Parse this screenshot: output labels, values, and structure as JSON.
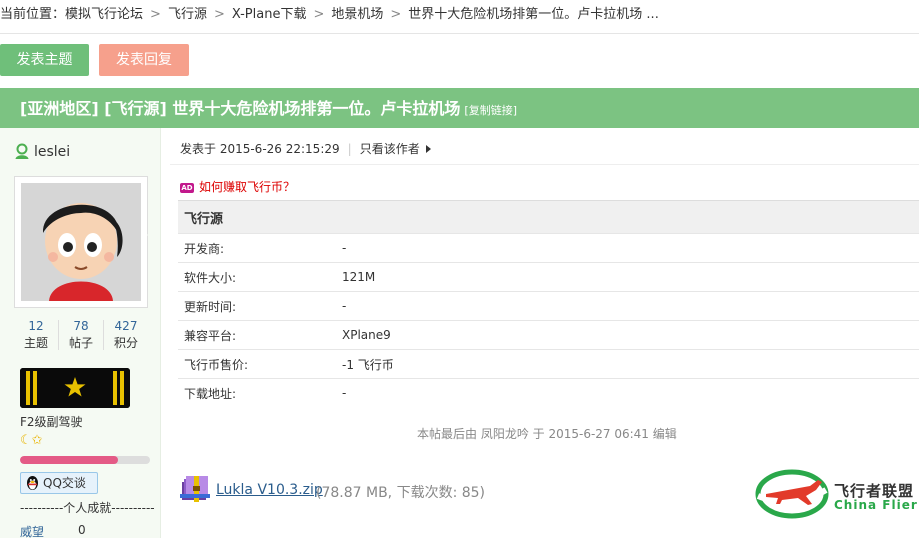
{
  "breadcrumb": {
    "prefix": "当前位置：",
    "items": [
      "模拟飞行论坛",
      "飞行源",
      "X-Plane下载",
      "地景机场",
      "世界十大危险机场排第一位。卢卡拉机场 ..."
    ],
    "separator": ">"
  },
  "actions": {
    "post_label": "发表主题",
    "reply_label": "发表回复"
  },
  "thread": {
    "title": "[亚洲地区] [飞行源] 世界十大危险机场排第一位。卢卡拉机场",
    "copy_link": "[复制链接]"
  },
  "author": {
    "name": "leslei",
    "stats": [
      {
        "num": "12",
        "label": "主题"
      },
      {
        "num": "78",
        "label": "帖子"
      },
      {
        "num": "427",
        "label": "积分"
      }
    ],
    "rank_title": "F2级副驾驶",
    "rank_icons": "☾✩",
    "progress": 0.75,
    "qq_label": "QQ交谈",
    "achievements_label": "----------个人成就----------",
    "weiwang_label": "威望",
    "weiwang_value": "0",
    "colors": {
      "sidebar_bg": "#f5faf3",
      "progress": "#e45a86"
    }
  },
  "post": {
    "posted_at": "发表于 2015-6-26 22:15:29",
    "only_author": "只看该作者",
    "ad_icon": "AD",
    "ad_text": "如何赚取飞行币？",
    "info_title": "飞行源",
    "info_rows": [
      {
        "key": "开发商:",
        "value": "-"
      },
      {
        "key": "软件大小:",
        "value": "121M"
      },
      {
        "key": "更新时间:",
        "value": "-"
      },
      {
        "key": "兼容平台:",
        "value": "XPlane9"
      },
      {
        "key": "飞行币售价:",
        "value": "-1 飞行币"
      },
      {
        "key": "下载地址:",
        "value": "-"
      }
    ],
    "edit_note": "本帖最后由 凤阳龙吟 于 2015-6-27 06:41 编辑",
    "attachment": {
      "file": "Lukla V10.3.zip",
      "meta": "(78.87 MB, 下载次数: 85)"
    }
  },
  "logo": {
    "cn": "飞行者联盟",
    "en": "China Flier"
  },
  "colors": {
    "title_bar": "#7cc382",
    "post_button": "#6fbf7a",
    "reply_button": "#f6a08c",
    "link": "#2a5c8c"
  }
}
